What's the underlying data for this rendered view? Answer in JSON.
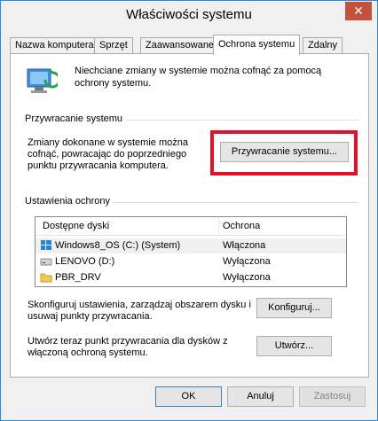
{
  "window": {
    "title": "Właściwości systemu",
    "close_glyph": "✕"
  },
  "tabs": [
    {
      "label": "Nazwa komputera"
    },
    {
      "label": "Sprzęt"
    },
    {
      "label": "Zaawansowane"
    },
    {
      "label": "Ochrona systemu"
    },
    {
      "label": "Zdalny"
    }
  ],
  "active_tab": "Ochrona systemu",
  "intro": {
    "text": "Niechciane zmiany w systemie można cofnąć za pomocą ochrony systemu.",
    "icon": "system-protection-icon"
  },
  "restore": {
    "group_label": "Przywracanie systemu",
    "description": "Zmiany dokonane w systemie można cofnąć, powracając do poprzedniego punktu przywracania komputera.",
    "button_label": "Przywracanie systemu..."
  },
  "protection": {
    "group_label": "Ustawienia ochrony",
    "columns": [
      "Dostępne dyski",
      "Ochrona"
    ],
    "rows": [
      {
        "name": "Windows8_OS (C:) (System)",
        "state": "Włączona",
        "icon": "windows-drive-icon"
      },
      {
        "name": "LENOVO (D:)",
        "state": "Wyłączona",
        "icon": "drive-icon"
      },
      {
        "name": "PBR_DRV",
        "state": "Wyłączona",
        "icon": "folder-icon"
      }
    ],
    "configure_text": "Skonfiguruj ustawienia, zarządzaj obszarem dysku i usuwaj punkty przywracania.",
    "configure_button": "Konfiguruj...",
    "create_text": "Utwórz teraz punkt przywracania dla dysków z włączoną ochroną systemu.",
    "create_button": "Utwórz..."
  },
  "footer": {
    "ok": "OK",
    "cancel": "Anuluj",
    "apply": "Zastosuj"
  },
  "colors": {
    "highlight": "#e0112a",
    "window_border": "#2b8ad8",
    "close_button": "#c7503d"
  }
}
